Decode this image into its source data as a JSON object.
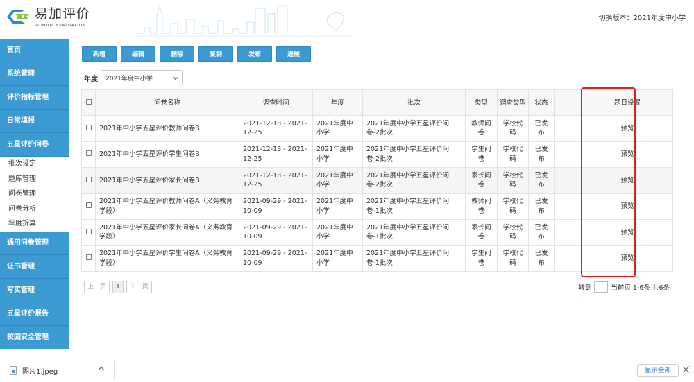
{
  "header": {
    "brand_cn": "易加评价",
    "brand_en": "SCHOOL EVALUATION",
    "version_label": "切换版本：",
    "version_value": "2021年度中小学",
    "colors": {
      "accent": "#3c9ad3",
      "logo_green": "#8cc63f",
      "logo_blue": "#2e8bd0"
    }
  },
  "sidebar": {
    "items": [
      {
        "label": "首页"
      },
      {
        "label": "系统管理"
      },
      {
        "label": "评价指标管理"
      },
      {
        "label": "日常填报"
      },
      {
        "label": "五星评价问卷"
      }
    ],
    "sub_items": [
      {
        "label": "批次设定"
      },
      {
        "label": "题库管理"
      },
      {
        "label": "问卷管理"
      },
      {
        "label": "问卷分析"
      },
      {
        "label": "年度折算"
      }
    ],
    "items_after": [
      {
        "label": "通用问卷管理"
      },
      {
        "label": "证书管理"
      },
      {
        "label": "写实管理"
      },
      {
        "label": "五星评价报告"
      },
      {
        "label": "校园安全管理"
      }
    ]
  },
  "toolbar": {
    "add": "新增",
    "edit": "编辑",
    "delete": "删除",
    "copy": "复制",
    "publish": "发布",
    "progress": "进展"
  },
  "filter": {
    "year_label": "年度",
    "year_value": "2021年度中小学"
  },
  "table": {
    "headers": {
      "name": "问卷名称",
      "time": "调查时间",
      "year": "年度",
      "batch": "批次",
      "type": "类型",
      "survey_type": "调查类型",
      "status": "状态",
      "settings": "题目设置"
    },
    "rows": [
      {
        "name": "2021年中小学五星评价教师问卷B",
        "time": "2021-12-18 - 2021-12-25",
        "year": "2021年度中小学",
        "batch": "2021年度中小学五星评价问卷-2批次",
        "type": "教师问卷",
        "survey_type": "学校代码",
        "status": "已发布",
        "preview": "预览"
      },
      {
        "name": "2021年中小学五星评价学生问卷B",
        "time": "2021-12-18 - 2021-12-25",
        "year": "2021年度中小学",
        "batch": "2021年度中小学五星评价问卷-2批次",
        "type": "学生问卷",
        "survey_type": "学校代码",
        "status": "已发布",
        "preview": "预览"
      },
      {
        "name": "2021年中小学五星评价家长问卷B",
        "time": "2021-12-18 - 2021-12-25",
        "year": "2021年度中小学",
        "batch": "2021年度中小学五星评价问卷-2批次",
        "type": "家长问卷",
        "survey_type": "学校代码",
        "status": "已发布",
        "preview": "预览"
      },
      {
        "name": "2021年中小学五星评价教师问卷A（义务教育学段）",
        "time": "2021-09-29 - 2021-10-09",
        "year": "2021年度中小学",
        "batch": "2021年度中小学五星评价问卷-1批次",
        "type": "教师问卷",
        "survey_type": "学校代码",
        "status": "已发布",
        "preview": "预览"
      },
      {
        "name": "2021年中小学五星评价家长问卷A（义务教育学段）",
        "time": "2021-09-29 - 2021-10-09",
        "year": "2021年度中小学",
        "batch": "2021年度中小学五星评价问卷-1批次",
        "type": "家长问卷",
        "survey_type": "学校代码",
        "status": "已发布",
        "preview": "预览"
      },
      {
        "name": "2021年中小学五星评价学生问卷A（义务教育学段）",
        "time": "2021-09-29 - 2021-10-09",
        "year": "2021年度中小学",
        "batch": "2021年度中小学五星评价问卷-1批次",
        "type": "学生问卷",
        "survey_type": "学校代码",
        "status": "已发布",
        "preview": "预览"
      }
    ]
  },
  "pager": {
    "prev": "上一页",
    "current": "1",
    "next": "下一页",
    "jump_label": "转到",
    "info": "当前页 1-6条 共6条"
  },
  "download_bar": {
    "file_name": "图片1.jpeg",
    "show_all": "显示全部"
  }
}
